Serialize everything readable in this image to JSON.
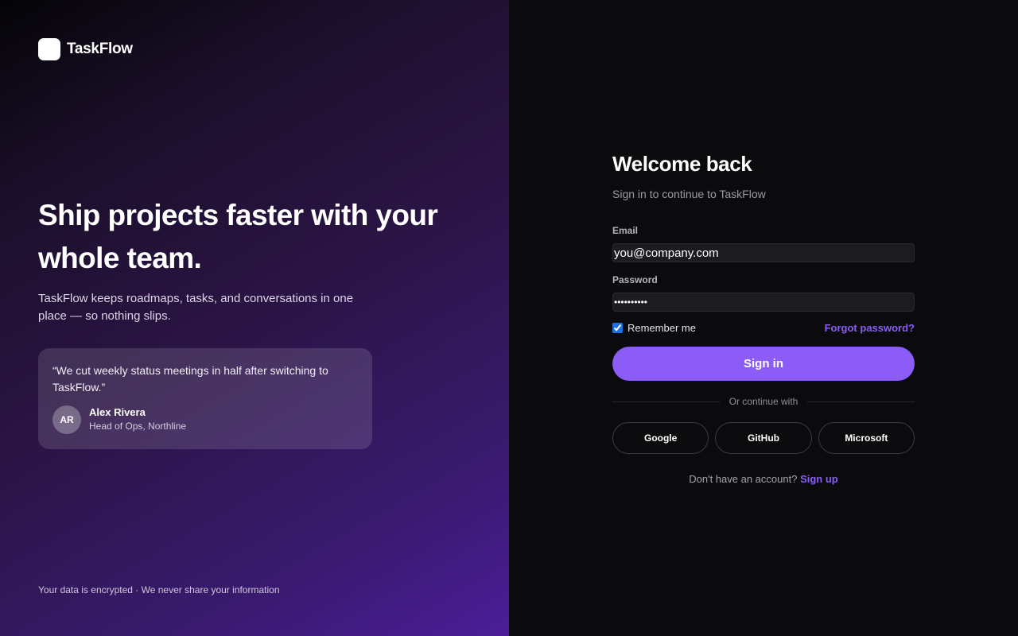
{
  "brand": {
    "name": "TaskFlow"
  },
  "hero": {
    "title": "Ship projects faster with your whole team.",
    "subtitle": "TaskFlow keeps roadmaps, tasks, and conversations in one place — so nothing slips."
  },
  "testimonial": {
    "quote": "“We cut weekly status meetings in half after switching to TaskFlow.”",
    "avatar_initials": "AR",
    "author": "Alex Rivera",
    "role": "Head of Ops, Northline"
  },
  "footnote": "Your data is encrypted · We never share your information",
  "form": {
    "title": "Welcome back",
    "subtitle": "Sign in to continue to TaskFlow",
    "email_label": "Email",
    "email_value": "you@company.com",
    "password_label": "Password",
    "password_value": "••••••••••",
    "remember_label": "Remember me",
    "remember_checked": true,
    "forgot_label": "Forgot password?",
    "signin_label": "Sign in",
    "divider_text": "Or continue with",
    "social": [
      "Google",
      "GitHub",
      "Microsoft"
    ],
    "signup_prompt": "Don't have an account?",
    "signup_link": "Sign up"
  },
  "colors": {
    "accent": "#8b5cf6",
    "right_background": "#0b0b0e",
    "gradient_end": "#4b1d98"
  }
}
